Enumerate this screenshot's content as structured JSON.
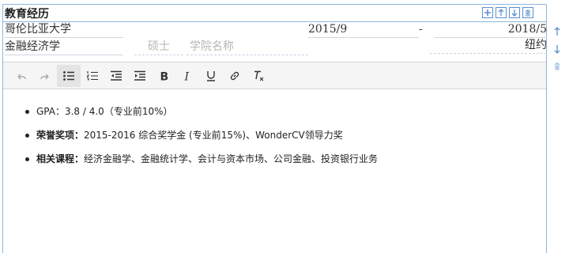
{
  "section": {
    "title": "教育经历"
  },
  "entry": {
    "school": "哥伦比亚大学",
    "start_date": "2015/9",
    "date_separator": "-",
    "end_date": "2018/5",
    "major": "金融经济学",
    "degree": "硕士",
    "college_placeholder": "学院名称",
    "location": "纽约"
  },
  "content": {
    "items": [
      {
        "label": "",
        "text": "GPA：3.8 / 4.0（专业前10%）"
      },
      {
        "label": "荣誉奖项：",
        "text": "2015-2016 综合奖学金 (专业前15%)、WonderCV领导力奖"
      },
      {
        "label": "相关课程：",
        "text": "经济金融学、金融统计学、会计与资本市场、公司金融、投资银行业务"
      }
    ]
  },
  "colors": {
    "accent": "#5b8fd1",
    "border": "#8fb6de",
    "toolbar_bg": "#f5f5f5"
  },
  "icons": {
    "section_tools": [
      "add-icon",
      "move-up-icon",
      "move-down-icon",
      "delete-icon"
    ],
    "toolbar": [
      "undo-icon",
      "redo-icon",
      "bullet-list-icon",
      "numbered-list-icon",
      "outdent-icon",
      "indent-icon",
      "bold-icon",
      "italic-icon",
      "underline-icon",
      "link-icon",
      "clear-format-icon"
    ],
    "side_tools": [
      "move-up-icon",
      "move-down-icon",
      "delete-icon"
    ]
  }
}
